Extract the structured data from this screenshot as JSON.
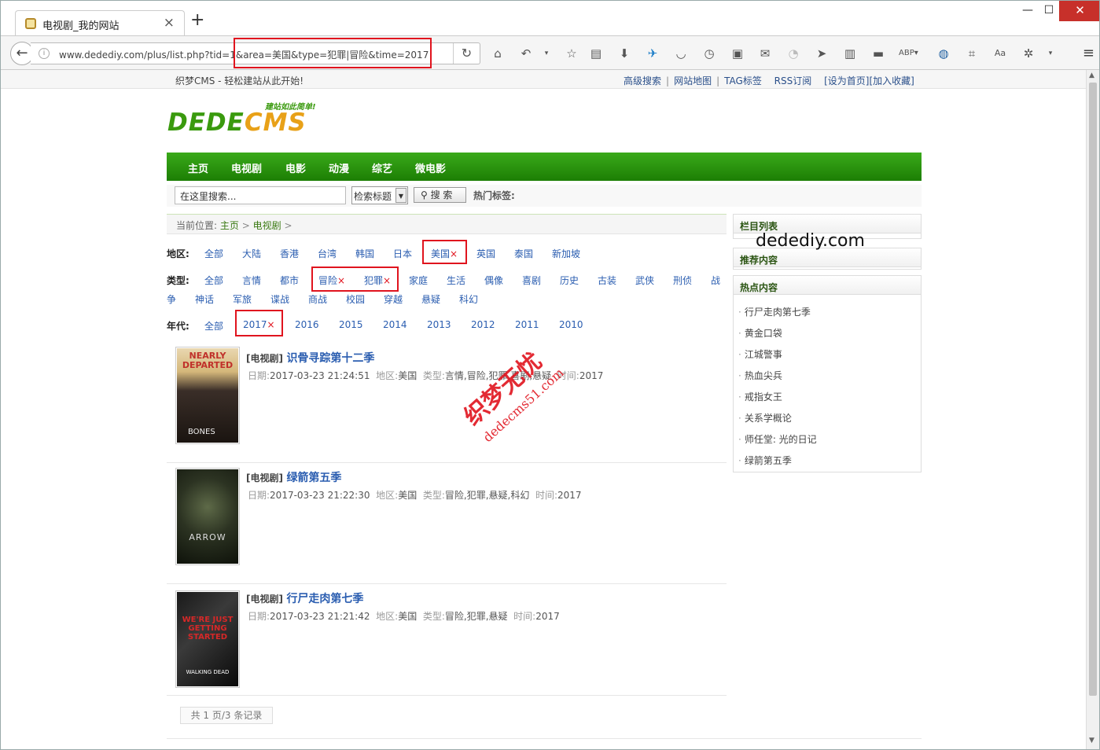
{
  "browser": {
    "tab_title": "电视剧_我的网站",
    "url": "www.dedediy.com/plus/list.php?tid=1&area=美国&type=犯罪|冒险&time=2017",
    "window_controls": {
      "minimize": "—",
      "maximize": "☐",
      "close": "✕"
    }
  },
  "site": {
    "slogan": "织梦CMS - 轻松建站从此开始!",
    "top_links": [
      "高级搜索",
      "网站地图",
      "TAG标签",
      "RSS订阅",
      "[设为首页]",
      "[加入收藏]"
    ],
    "logo_text": "DEDE",
    "logo_text_accent": "CMS",
    "logo_tagline": "建站如此简单!",
    "nav": [
      "主页",
      "电视剧",
      "电影",
      "动漫",
      "综艺",
      "微电影"
    ],
    "search": {
      "input_value": "在这里搜索...",
      "select_value": "检索标题",
      "button": "搜 索",
      "hot_tags_label": "热门标签:"
    }
  },
  "breadcrumb": {
    "label": "当前位置:",
    "items": [
      "主页",
      "电视剧"
    ],
    "sep": ">"
  },
  "filters": {
    "area": {
      "label": "地区:",
      "options": [
        "全部",
        "大陆",
        "香港",
        "台湾",
        "韩国",
        "日本",
        "美国",
        "英国",
        "泰国",
        "新加坡"
      ],
      "selected": "美国"
    },
    "type": {
      "label": "类型:",
      "row1": [
        "全部",
        "言情",
        "都市",
        "冒险",
        "犯罪",
        "家庭",
        "生活",
        "偶像",
        "喜剧",
        "历史",
        "古装",
        "武侠",
        "刑侦",
        "战"
      ],
      "row2": [
        "争",
        "神话",
        "军旅",
        "谍战",
        "商战",
        "校园",
        "穿越",
        "悬疑",
        "科幻"
      ],
      "selected": [
        "冒险",
        "犯罪"
      ]
    },
    "time": {
      "label": "年代:",
      "options": [
        "全部",
        "2017",
        "2016",
        "2015",
        "2014",
        "2013",
        "2012",
        "2011",
        "2010"
      ],
      "selected": "2017"
    },
    "remove_mark": "×"
  },
  "movies": [
    {
      "category": "[电视剧]",
      "title": "识骨寻踪第十二季",
      "date_label": "日期:",
      "date": "2017-03-23 21:24:51",
      "area_label": "地区:",
      "area": "美国",
      "type_label": "类型:",
      "type": "言情,冒险,犯罪,喜剧,悬疑",
      "time_label": "时间:",
      "time": "2017",
      "poster_text": "NEARLY DEPARTED",
      "poster_sub": "BONES"
    },
    {
      "category": "[电视剧]",
      "title": "绿箭第五季",
      "date_label": "日期:",
      "date": "2017-03-23 21:22:30",
      "area_label": "地区:",
      "area": "美国",
      "type_label": "类型:",
      "type": "冒险,犯罪,悬疑,科幻",
      "time_label": "时间:",
      "time": "2017",
      "poster_text": "ARROW",
      "poster_sub": ""
    },
    {
      "category": "[电视剧]",
      "title": "行尸走肉第七季",
      "date_label": "日期:",
      "date": "2017-03-23 21:21:42",
      "area_label": "地区:",
      "area": "美国",
      "type_label": "类型:",
      "type": "冒险,犯罪,悬疑",
      "time_label": "时间:",
      "time": "2017",
      "poster_text": "WE'RE JUST GETTING STARTED",
      "poster_sub": "WALKING DEAD"
    }
  ],
  "pager": "共 1 页/3 条记录",
  "sidebar": {
    "column_list": "栏目列表",
    "recommended": "推荐内容",
    "hot": "热点内容",
    "hot_items": [
      "行尸走肉第七季",
      "黄金口袋",
      "江城警事",
      "热血尖兵",
      "戒指女王",
      "关系学概论",
      "师任堂: 光的日记",
      "绿箭第五季"
    ]
  },
  "watermarks": {
    "site": "dedediy.com",
    "cn": "织梦无忧",
    "en": "dedecms51.com"
  },
  "colors": {
    "nav_green": "#2a9a0e",
    "link_blue": "#2a5db0",
    "highlight_red": "#e0141e"
  }
}
